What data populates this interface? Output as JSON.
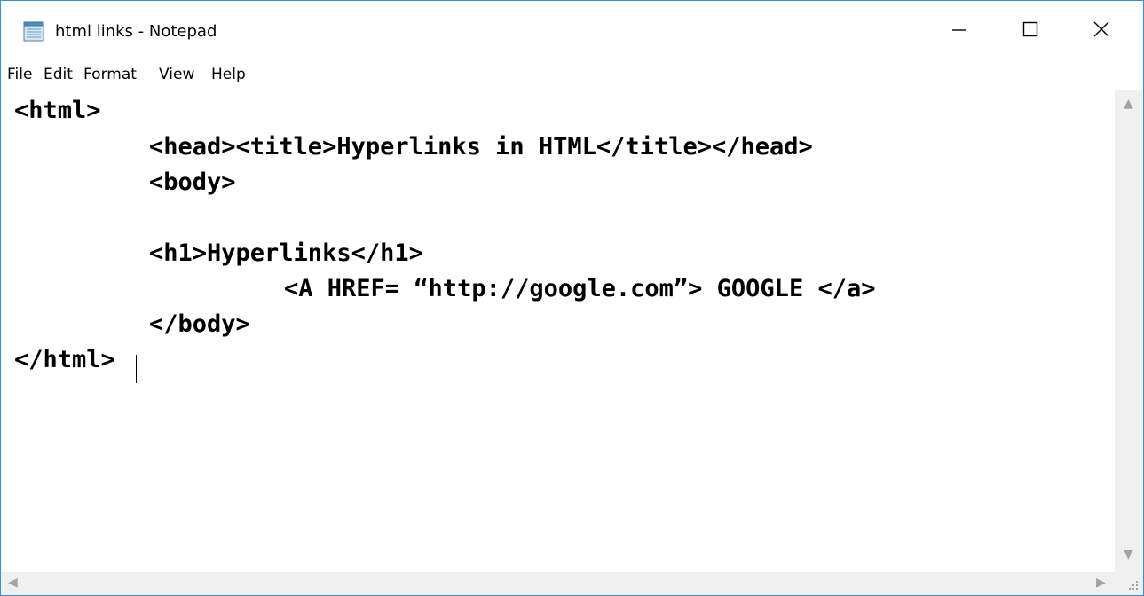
{
  "window": {
    "title": "html links - Notepad",
    "icons": {
      "app": "notepad-icon",
      "minimize": "minimize-icon",
      "maximize": "maximize-icon",
      "close": "close-icon"
    }
  },
  "menu": {
    "file": "File",
    "edit": "Edit",
    "format": "Format",
    "view": "View",
    "help": "Help"
  },
  "editor": {
    "lines": [
      "<html>",
      "<head><title>Hyperlinks in HTML</title></head>",
      "<body>",
      "",
      "<h1>Hyperlinks</h1>",
      "<A HREF= “http://google.com”> GOOGLE </a>",
      "</body>",
      "</html>"
    ]
  },
  "scrollbars": {
    "up": "▲",
    "down": "▼",
    "left": "◀",
    "right": "▶"
  },
  "colors": {
    "border": "#3c8dd6",
    "scrollbar": "#f0f0f0",
    "text": "#000000"
  }
}
